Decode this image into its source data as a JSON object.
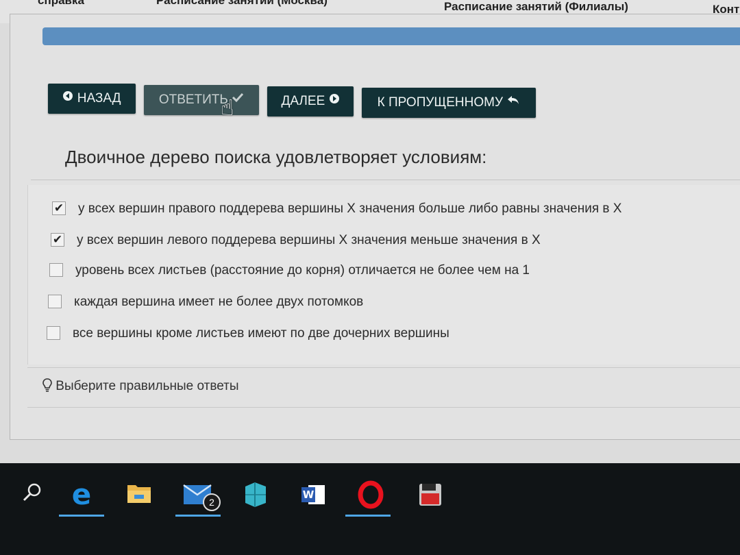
{
  "topnav": {
    "help": "справка",
    "schedule_moscow": "Расписание занятий (Москва)",
    "schedule_branches": "Расписание занятий (Филиалы)",
    "contacts": "Конт"
  },
  "toolbar": {
    "back_label": "НАЗАД",
    "answer_label": "ОТВЕТИТЬ",
    "next_label": "ДАЛЕЕ",
    "skipped_label": "К ПРОПУЩЕННОМУ"
  },
  "question": {
    "text": "Двоичное дерево поиска удовлетворяет условиям:",
    "options": [
      {
        "label": "у всех вершин правого поддерева вершины X значения больше либо равны значения в X",
        "checked": true
      },
      {
        "label": "у всех вершин левого поддерева вершины X значения меньше значения в X",
        "checked": true
      },
      {
        "label": "уровень всех листьев (расстояние до корня) отличается не более чем на 1",
        "checked": false
      },
      {
        "label": "каждая вершина имеет не более двух потомков",
        "checked": false
      },
      {
        "label": "все вершины кроме листьев имеют по две дочерних вершины",
        "checked": false
      }
    ],
    "hint": "Выберите правильные ответы"
  },
  "taskbar": {
    "mail_badge": "2",
    "items": [
      "search-icon",
      "edge-icon",
      "file-explorer-icon",
      "mail-icon",
      "azure-icon",
      "word-icon",
      "opera-icon",
      "save-app-icon"
    ]
  },
  "colors": {
    "button_bg": "#123136",
    "progress_bar": "#5c8fc0",
    "taskbar_bg": "#101416",
    "taskbar_active": "#4ea6e6"
  }
}
